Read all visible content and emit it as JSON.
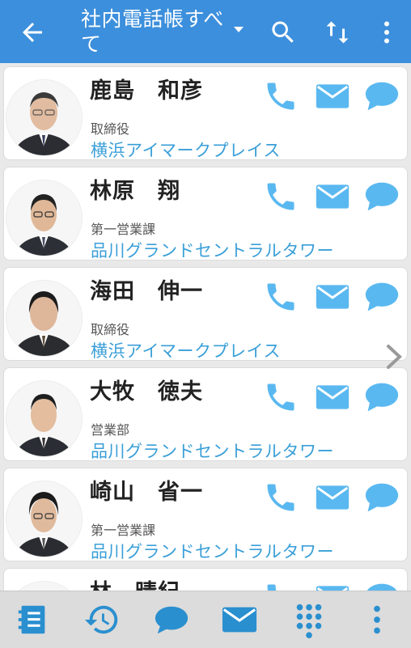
{
  "header": {
    "title": "社内電話帳すべて",
    "back_icon": "back-arrow-icon",
    "search_icon": "search-icon",
    "sort_icon": "sort-icon",
    "more_icon": "more-vert-icon"
  },
  "colors": {
    "header_bg": "#3c8fdc",
    "action_blue": "#5ab8f0",
    "office_text": "#3a9fd8",
    "bottom_bar_bg": "#dcdcdc",
    "bottom_icon": "#2a8fcf"
  },
  "contacts": [
    {
      "name": "鹿島　和彦",
      "dept": "取締役",
      "office": "横浜アイマークプレイス"
    },
    {
      "name": "林原　翔",
      "dept": "第一営業課",
      "office": "品川グランドセントラルタワー"
    },
    {
      "name": "海田　伸一",
      "dept": "取締役",
      "office": "横浜アイマークプレイス"
    },
    {
      "name": "大牧　徳夫",
      "dept": "営業部",
      "office": "品川グランドセントラルタワー"
    },
    {
      "name": "崎山　省一",
      "dept": "第一営業課",
      "office": "品川グランドセントラルタワー"
    },
    {
      "name": "林　晴紀",
      "dept": "",
      "office": ""
    }
  ],
  "bottom_nav": [
    "phonebook-icon",
    "history-icon",
    "chat-icon",
    "mail-icon",
    "dialpad-icon",
    "more-vert-icon"
  ]
}
